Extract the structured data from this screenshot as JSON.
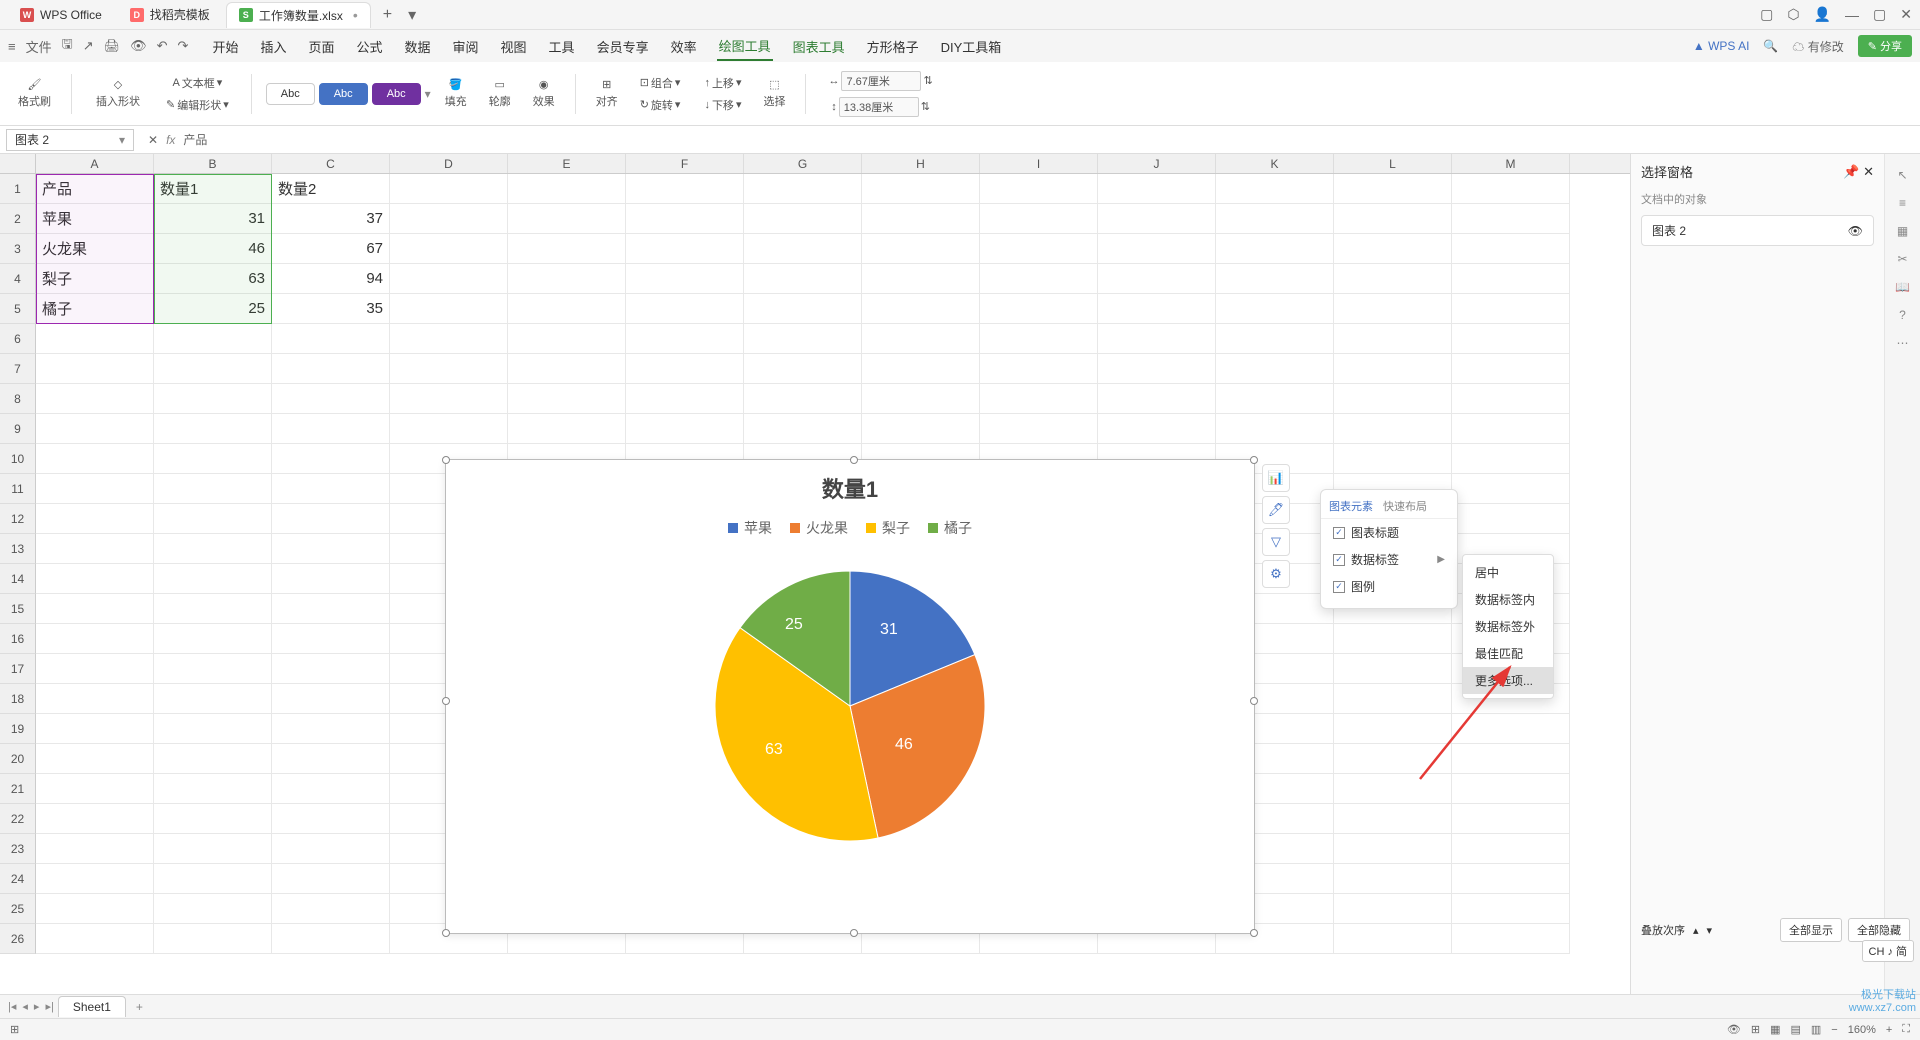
{
  "titlebar": {
    "app_name": "WPS Office",
    "tab_template": "找稻壳模板",
    "tab_file": "工作簿数量.xlsx"
  },
  "menubar": {
    "file": "文件",
    "items": [
      "开始",
      "插入",
      "页面",
      "公式",
      "数据",
      "审阅",
      "视图",
      "工具",
      "会员专享",
      "效率",
      "绘图工具",
      "图表工具",
      "方形格子",
      "DIY工具箱"
    ],
    "wps_ai": "WPS AI",
    "modified": "有修改",
    "share": "分享"
  },
  "ribbon": {
    "format_brush": "格式刷",
    "insert_shape": "插入形状",
    "text_box": "文本框",
    "edit_shape": "编辑形状",
    "abc": "Abc",
    "fill": "填充",
    "outline": "轮廓",
    "effect": "效果",
    "align": "对齐",
    "group": "组合",
    "rotate": "旋转",
    "move_up": "上移",
    "move_down": "下移",
    "select": "选择",
    "width_val": "7.67厘米",
    "height_val": "13.38厘米"
  },
  "formula": {
    "name_box": "图表 2",
    "content": "产品"
  },
  "columns": [
    "A",
    "B",
    "C",
    "D",
    "E",
    "F",
    "G",
    "H",
    "I",
    "J",
    "K",
    "L",
    "M"
  ],
  "rows_count": 26,
  "table": {
    "headers": [
      "产品",
      "数量1",
      "数量2"
    ],
    "rows": [
      [
        "苹果",
        "31",
        "37"
      ],
      [
        "火龙果",
        "46",
        "67"
      ],
      [
        "梨子",
        "63",
        "94"
      ],
      [
        "橘子",
        "25",
        "35"
      ]
    ]
  },
  "chart_data": {
    "type": "pie",
    "title": "数量1",
    "series": [
      {
        "name": "苹果",
        "value": 31,
        "color": "#4472c4"
      },
      {
        "name": "火龙果",
        "value": 46,
        "color": "#ed7d31"
      },
      {
        "name": "梨子",
        "value": 63,
        "color": "#ffc000"
      },
      {
        "name": "橘子",
        "value": 25,
        "color": "#70ad47"
      }
    ],
    "labels": [
      "31",
      "46",
      "63",
      "25"
    ]
  },
  "chart_popup": {
    "tab_elements": "图表元素",
    "tab_layout": "快速布局",
    "opt_title": "图表标题",
    "opt_labels": "数据标签",
    "opt_legend": "图例",
    "submenu": [
      "居中",
      "数据标签内",
      "数据标签外",
      "最佳匹配",
      "更多选项..."
    ]
  },
  "right_panel": {
    "title": "选择窗格",
    "subtitle": "文档中的对象",
    "object": "图表 2",
    "stack_order": "叠放次序",
    "show_all": "全部显示",
    "hide_all": "全部隐藏"
  },
  "sheet_tabs": {
    "sheet1": "Sheet1"
  },
  "statusbar": {
    "zoom": "160%"
  },
  "ime": "CH ♪ 简",
  "watermark": {
    "line1": "极光下载站",
    "line2": "www.xz7.com"
  }
}
